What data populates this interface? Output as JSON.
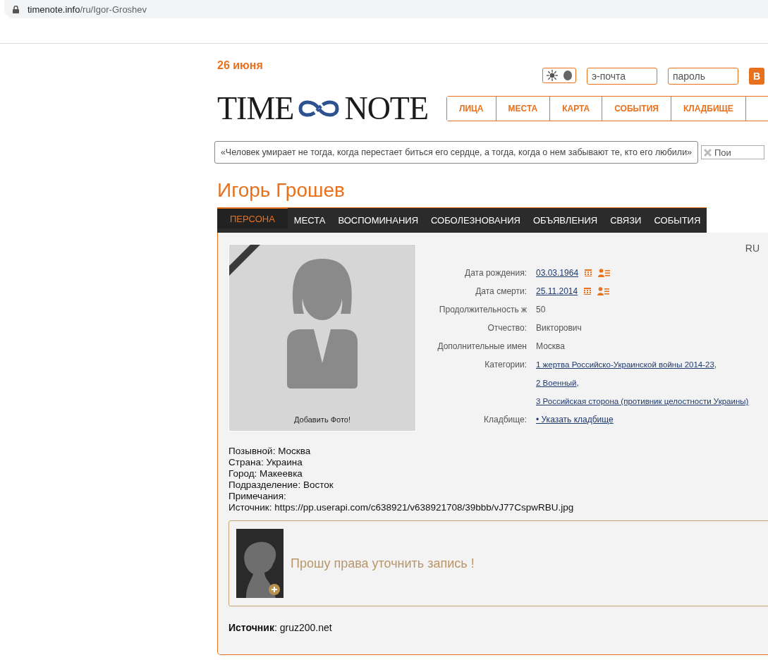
{
  "address_bar": {
    "host": "timenote.info",
    "path": "/ru/Igor-Groshev"
  },
  "header": {
    "date": "26 июня",
    "dark_mode": false,
    "email_placeholder": "э-почта",
    "password_placeholder": "пароль",
    "login_button": "В"
  },
  "logo": {
    "left": "TIME",
    "right": "NOTE"
  },
  "nav": [
    "ЛИЦА",
    "МЕСТА",
    "КАРТА",
    "СОБЫТИЯ",
    "КЛАДБИЩЕ"
  ],
  "quote": "«Человек умирает не тогда, когда перестает биться его сердце, а тогда, когда о нем забывают те, кто его любили»",
  "search": {
    "placeholder": "Пои"
  },
  "person_name": "Игорь Грошев",
  "tabs": [
    {
      "label": "ПЕРСОНА",
      "selected": true
    },
    {
      "label": "МЕСТА",
      "selected": false
    },
    {
      "label": "ВОСПОМИНАНИЯ",
      "selected": false
    },
    {
      "label": "СОБОЛЕЗНОВАНИЯ",
      "selected": false
    },
    {
      "label": "ОБЪЯВЛЕНИЯ",
      "selected": false
    },
    {
      "label": "СВЯЗИ",
      "selected": false
    },
    {
      "label": "СОБЫТИЯ",
      "selected": false
    }
  ],
  "language": "RU",
  "photo": {
    "caption": "Добавить Фото!"
  },
  "details": [
    {
      "kind": "date",
      "label": "Дата рождения:",
      "value": "03.03.1964"
    },
    {
      "kind": "date",
      "label": "Дата смерти:",
      "value": "25.11.2014"
    },
    {
      "kind": "text",
      "label": "Продолжительность ж",
      "value": "50"
    },
    {
      "kind": "text",
      "label": "Отчество:",
      "value": "Викторович"
    },
    {
      "kind": "text",
      "label": "Дополнительные имен",
      "value": "Москва"
    },
    {
      "kind": "links",
      "label": "Категории:",
      "separator": ",",
      "links": [
        "1 жертва Российско-Украинской войны 2014-23",
        "2 Военный",
        "3 Российская сторона (противник целостности Украины)"
      ]
    },
    {
      "kind": "action",
      "label": "Кладбище:",
      "value": "• Указать кладбище"
    }
  ],
  "info_lines": [
    "Позывной: Москва",
    "Страна: Украина",
    "Город: Макеевка",
    "Подразделение: Восток",
    "Примечания:",
    "Источник: https://pp.userapi.com/c638921/v638921708/39bbb/vJ77CspwRBU.jpg"
  ],
  "request": {
    "text": "Прошу права уточнить запись !"
  },
  "source": "**Источник**: gruz200.net"
}
